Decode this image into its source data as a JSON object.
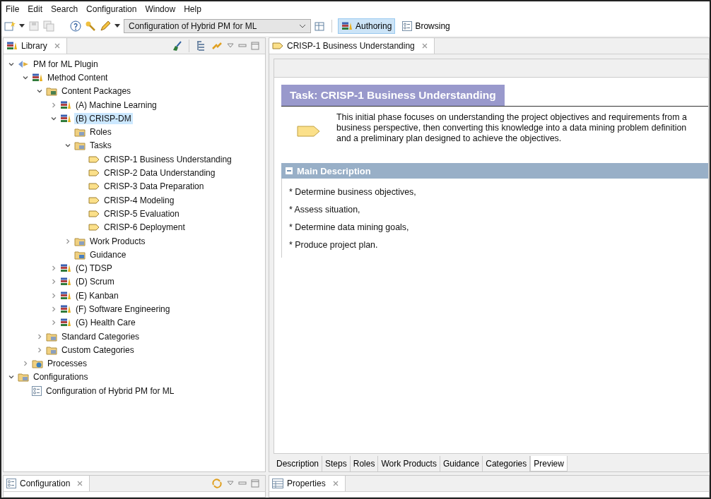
{
  "menu": [
    "File",
    "Edit",
    "Search",
    "Configuration",
    "Window",
    "Help"
  ],
  "toolbar": {
    "config_select": "Configuration of Hybrid PM for ML",
    "perspectives": [
      {
        "label": "Authoring",
        "selected": true
      },
      {
        "label": "Browsing",
        "selected": false
      }
    ]
  },
  "library": {
    "title": "Library",
    "tree": [
      {
        "label": "PM for ML Plugin",
        "kind": "plugin",
        "expanded": true,
        "selected": false,
        "children": [
          {
            "label": "Method Content",
            "kind": "package",
            "expanded": true,
            "selected": false,
            "children": [
              {
                "label": "Content Packages",
                "kind": "contentfolder",
                "expanded": true,
                "selected": false,
                "children": [
                  {
                    "label": "(A) Machine Learning",
                    "kind": "package",
                    "expanded": false,
                    "selected": false
                  },
                  {
                    "label": "(B) CRISP-DM",
                    "kind": "package",
                    "expanded": true,
                    "selected": true,
                    "children": [
                      {
                        "label": "Roles",
                        "kind": "roles",
                        "selected": false
                      },
                      {
                        "label": "Tasks",
                        "kind": "tasks",
                        "expanded": true,
                        "selected": false,
                        "children": [
                          {
                            "label": "CRISP-1 Business Understanding",
                            "kind": "task",
                            "selected": false
                          },
                          {
                            "label": "CRISP-2 Data Understanding",
                            "kind": "task",
                            "selected": false
                          },
                          {
                            "label": "CRISP-3 Data Preparation",
                            "kind": "task",
                            "selected": false
                          },
                          {
                            "label": "CRISP-4 Modeling",
                            "kind": "task",
                            "selected": false
                          },
                          {
                            "label": "CRISP-5 Evaluation",
                            "kind": "task",
                            "selected": false
                          },
                          {
                            "label": "CRISP-6 Deployment",
                            "kind": "task",
                            "selected": false
                          }
                        ]
                      },
                      {
                        "label": "Work Products",
                        "kind": "workproducts",
                        "expanded": false,
                        "selected": false
                      },
                      {
                        "label": "Guidance",
                        "kind": "guidance",
                        "selected": false
                      }
                    ]
                  },
                  {
                    "label": "(C) TDSP",
                    "kind": "package",
                    "expanded": false,
                    "selected": false
                  },
                  {
                    "label": "(D) Scrum",
                    "kind": "package",
                    "expanded": false,
                    "selected": false
                  },
                  {
                    "label": "(E) Kanban",
                    "kind": "package",
                    "expanded": false,
                    "selected": false
                  },
                  {
                    "label": "(F) Software Engineering",
                    "kind": "package",
                    "expanded": false,
                    "selected": false
                  },
                  {
                    "label": "(G) Health Care",
                    "kind": "package",
                    "expanded": false,
                    "selected": false
                  }
                ]
              },
              {
                "label": "Standard Categories",
                "kind": "categories",
                "expanded": false,
                "selected": false
              },
              {
                "label": "Custom Categories",
                "kind": "categories",
                "expanded": false,
                "selected": false
              }
            ]
          },
          {
            "label": "Processes",
            "kind": "processes",
            "expanded": false,
            "selected": false
          }
        ]
      },
      {
        "label": "Configurations",
        "kind": "configfolder",
        "expanded": true,
        "selected": false,
        "children": [
          {
            "label": "Configuration of Hybrid PM for ML",
            "kind": "config",
            "selected": false
          }
        ]
      }
    ]
  },
  "editor": {
    "tab": "CRISP-1 Business Understanding",
    "heading": "Task: CRISP-1 Business Understanding",
    "summary": "This initial phase focuses on understanding the project objectives and requirements from a business perspective, then converting this knowledge into a data mining problem definition and a preliminary plan designed to achieve the objectives.",
    "section": "Main Description",
    "bullets": [
      "* Determine business objectives,",
      "* Assess situation,",
      "* Determine data mining goals,",
      "* Produce project plan."
    ],
    "tabs": [
      {
        "label": "Description",
        "selected": false
      },
      {
        "label": "Steps",
        "selected": false
      },
      {
        "label": "Roles",
        "selected": false
      },
      {
        "label": "Work Products",
        "selected": false
      },
      {
        "label": "Guidance",
        "selected": false
      },
      {
        "label": "Categories",
        "selected": false
      },
      {
        "label": "Preview",
        "selected": true
      }
    ]
  },
  "configuration_view": {
    "title": "Configuration"
  },
  "properties_view": {
    "title": "Properties"
  }
}
